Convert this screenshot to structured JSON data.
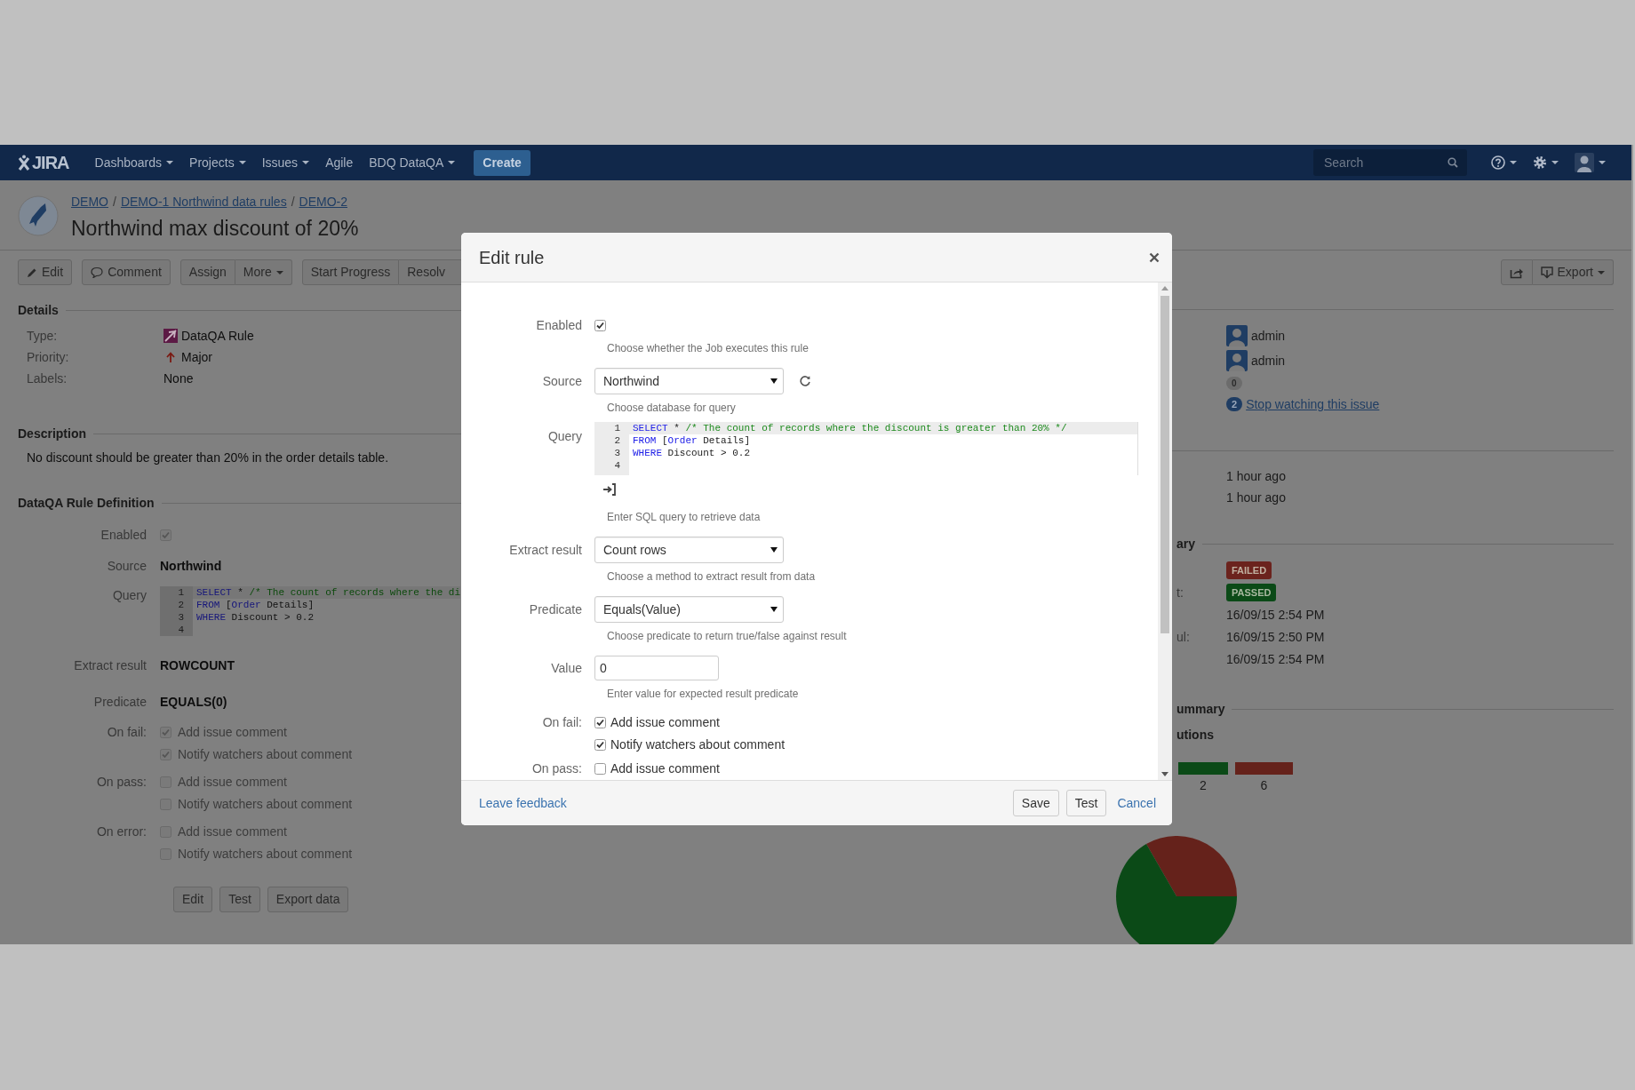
{
  "nav": {
    "logo": "JIRA",
    "menus": [
      {
        "label": "Dashboards",
        "dropdown": true
      },
      {
        "label": "Projects",
        "dropdown": true
      },
      {
        "label": "Issues",
        "dropdown": true
      },
      {
        "label": "Agile",
        "dropdown": false
      },
      {
        "label": "BDQ DataQA",
        "dropdown": true
      }
    ],
    "create": "Create",
    "search": {
      "placeholder": "Search"
    }
  },
  "issue": {
    "breadcrumbs": [
      {
        "text": "DEMO",
        "kind": "link"
      },
      {
        "text": "/",
        "kind": "separator"
      },
      {
        "text": "DEMO-1 Northwind data rules",
        "kind": "link"
      },
      {
        "text": "/",
        "kind": "separator"
      },
      {
        "text": "DEMO-2",
        "kind": "link"
      }
    ],
    "title": "Northwind max discount of 20%"
  },
  "toolbar": {
    "groups": [
      [
        {
          "label": "Edit",
          "kind": "edit"
        }
      ],
      [
        {
          "label": "Comment",
          "kind": "comment"
        }
      ],
      [
        {
          "label": "Assign",
          "kind": "plain"
        },
        {
          "label": "More",
          "kind": "dropdown"
        }
      ],
      [
        {
          "label": "Start Progress",
          "kind": "plain"
        },
        {
          "label": "Resolv",
          "kind": "plain"
        }
      ]
    ],
    "right": [
      {
        "kind": "share"
      },
      {
        "label": "Export",
        "kind": "export"
      }
    ]
  },
  "details": {
    "heading": "Details",
    "fields": [
      {
        "label": "Type:",
        "value": "DataQA Rule",
        "kind": "type"
      },
      {
        "label": "Priority:",
        "value": "Major",
        "kind": "priority"
      },
      {
        "label": "Labels:",
        "value": "None",
        "kind": "text"
      }
    ]
  },
  "description": {
    "heading": "Description",
    "text": "No discount should be greater than 20% in the order details table."
  },
  "rule_definition": {
    "heading": "DataQA Rule Definition",
    "enabled": {
      "label": "Enabled",
      "checked": true
    },
    "source": {
      "label": "Source",
      "value": "Northwind"
    },
    "query": {
      "label": "Query",
      "lines": [
        {
          "number": "1",
          "tokens": [
            {
              "text": "SELECT",
              "kind": "keyword"
            },
            {
              "text": " * ",
              "kind": "plain"
            },
            {
              "text": "/* The count of records where the di",
              "kind": "comment"
            }
          ]
        },
        {
          "number": "2",
          "tokens": [
            {
              "text": "FROM",
              "kind": "keyword"
            },
            {
              "text": " [",
              "kind": "plain"
            },
            {
              "text": "Order",
              "kind": "keyword"
            },
            {
              "text": " Details]",
              "kind": "plain"
            }
          ]
        },
        {
          "number": "3",
          "tokens": [
            {
              "text": "WHERE",
              "kind": "keyword"
            },
            {
              "text": " Discount > 0.2",
              "kind": "plain"
            }
          ]
        },
        {
          "number": "4"
        }
      ]
    },
    "extract": {
      "label": "Extract result",
      "value": "ROWCOUNT"
    },
    "predicate": {
      "label": "Predicate",
      "value": "EQUALS(0)"
    },
    "actions": [
      {
        "label": "On fail:",
        "options": [
          {
            "label": "Add issue comment",
            "checked": true
          },
          {
            "label": "Notify watchers about comment",
            "checked": true
          }
        ]
      },
      {
        "label": "On pass:",
        "options": [
          {
            "label": "Add issue comment",
            "checked": false
          },
          {
            "label": "Notify watchers about comment",
            "checked": false
          }
        ]
      },
      {
        "label": "On error:",
        "options": [
          {
            "label": "Add issue comment",
            "checked": false
          },
          {
            "label": "Notify watchers about comment",
            "checked": false
          }
        ]
      }
    ],
    "buttons": [
      "Edit",
      "Test",
      "Export data"
    ]
  },
  "people": {
    "assignee": "admin",
    "reporter": "admin",
    "votes": "0",
    "watch": {
      "count": "2",
      "label": "Stop watching this issue"
    }
  },
  "dates": [
    "1 hour ago",
    "1 hour ago"
  ],
  "summary": {
    "heading": "ary",
    "rows": [
      {
        "value": "FAILED",
        "kind": "badge",
        "color": "#6b231d"
      },
      {
        "label": "t:",
        "value": "PASSED",
        "kind": "badge",
        "color": "#0b4a17"
      },
      {
        "value": "16/09/15 2:54 PM",
        "kind": "text"
      },
      {
        "label": "ul:",
        "value": "16/09/15 2:50 PM",
        "kind": "text"
      },
      {
        "value": "16/09/15 2:54 PM",
        "kind": "text"
      }
    ]
  },
  "execution_summary": {
    "heading": "ummary",
    "subheading": "utions",
    "bars": [
      {
        "label": "2",
        "color": "#0b4a17"
      },
      {
        "label": "6",
        "color": "#65221b"
      }
    ]
  },
  "modal": {
    "title": "Edit rule",
    "fields": [
      {
        "kind": "checkbox",
        "label": "Enabled",
        "checked": true,
        "help": "Choose whether the Job executes this rule"
      },
      {
        "kind": "select",
        "label": "Source",
        "value": "Northwind",
        "refresh_button": true,
        "help": "Choose database for query"
      },
      {
        "kind": "code",
        "label": "Query",
        "lines": [
          {
            "number": "1",
            "tokens": [
              {
                "text": "SELECT",
                "kind": "keyword"
              },
              {
                "text": " * ",
                "kind": "plain"
              },
              {
                "text": "/* The count of records where the discount is greater than 20% */",
                "kind": "comment"
              }
            ]
          },
          {
            "number": "2",
            "tokens": [
              {
                "text": "FROM",
                "kind": "keyword"
              },
              {
                "text": " [",
                "kind": "plain"
              },
              {
                "text": "Order",
                "kind": "keyword"
              },
              {
                "text": " Details]",
                "kind": "plain"
              }
            ]
          },
          {
            "number": "3",
            "tokens": [
              {
                "text": "WHERE",
                "kind": "keyword"
              },
              {
                "text": " Discount > 0.2",
                "kind": "plain"
              }
            ]
          },
          {
            "number": "4"
          }
        ],
        "help": "Enter SQL query to retrieve data"
      },
      {
        "kind": "select",
        "label": "Extract result",
        "value": "Count rows",
        "refresh_button": false,
        "help": "Choose a method to extract result from data"
      },
      {
        "kind": "select",
        "label": "Predicate",
        "value": "Equals(Value)",
        "refresh_button": false,
        "help": "Choose predicate to return true/false against result"
      },
      {
        "kind": "input",
        "label": "Value",
        "value": "0",
        "help": "Enter value for expected result predicate"
      },
      {
        "kind": "checks",
        "label": "On fail:",
        "options": [
          {
            "label": "Add issue comment",
            "checked": true
          },
          {
            "label": "Notify watchers about comment",
            "checked": true
          }
        ]
      },
      {
        "kind": "checks",
        "label": "On pass:",
        "options": [
          {
            "label": "Add issue comment",
            "checked": false
          }
        ]
      }
    ],
    "footer": {
      "feedback": "Leave feedback",
      "buttons": [
        "Save",
        "Test"
      ],
      "cancel": "Cancel"
    }
  }
}
